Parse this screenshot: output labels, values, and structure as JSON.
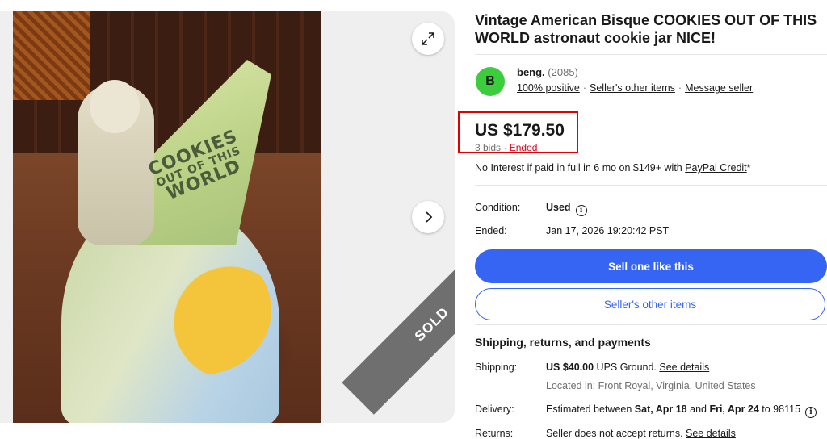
{
  "gallery": {
    "jar_text_line1": "COOKIES",
    "jar_text_line2": "OUT OF THIS",
    "jar_text_line3": "WORLD",
    "sold_badge": "SOLD",
    "expand_icon": "expand-icon",
    "next_icon": "chevron-right-icon"
  },
  "listing": {
    "title": "Vintage American Bisque COOKIES OUT OF THIS WORLD astronaut cookie jar NICE!"
  },
  "seller": {
    "avatar_letter": "B",
    "name": "beng.",
    "feedback_count": "(2085)",
    "positive": "100% positive",
    "other_items": "Seller's other items",
    "message": "Message seller"
  },
  "price": {
    "amount": "US $179.50",
    "bids": "3 bids",
    "status": "Ended",
    "paypal_text": "No Interest if paid in full in 6 mo on $149+ with ",
    "paypal_link": "PayPal Credit",
    "paypal_suffix": "*"
  },
  "details": {
    "condition_label": "Condition:",
    "condition_value": "Used",
    "ended_label": "Ended:",
    "ended_value": "Jan 17, 2026 19:20:42 PST"
  },
  "actions": {
    "sell_one": "Sell one like this",
    "sellers_items": "Seller's other items"
  },
  "shipping": {
    "section_title": "Shipping, returns, and payments",
    "shipping_label": "Shipping:",
    "shipping_price": "US $40.00",
    "shipping_method": " UPS Ground. ",
    "shipping_link": "See details",
    "location": "Located in: Front Royal, Virginia, United States",
    "delivery_label": "Delivery:",
    "delivery_prefix": "Estimated between ",
    "delivery_start": "Sat, Apr 18",
    "delivery_and": " and ",
    "delivery_end": "Fri, Apr 24",
    "delivery_suffix": " to 98115",
    "returns_label": "Returns:",
    "returns_value": "Seller does not accept returns. ",
    "returns_link": "See details"
  },
  "colors": {
    "accent": "#3665f3",
    "ended": "#e0001b",
    "highlight_box": "#e30000",
    "avatar": "#3bcd3b"
  }
}
